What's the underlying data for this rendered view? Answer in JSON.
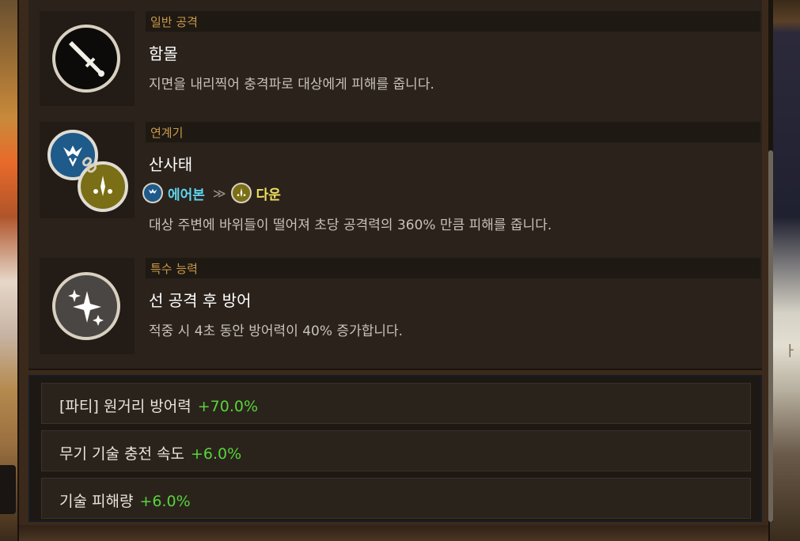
{
  "skills": [
    {
      "category": "일반 공격",
      "name": "함몰",
      "description": "지면을 내리찍어 충격파로 대상에게 피해를 줍니다.",
      "icon": "sword-icon"
    },
    {
      "category": "연계기",
      "name": "산사태",
      "combo": {
        "from": "에어본",
        "to": "다운",
        "arrow": "≫"
      },
      "description": "대상 주변에 바위들이 떨어져 초당 공격력의 360% 만큼 피해를 줍니다.",
      "icon": "chain-combo-icon"
    },
    {
      "category": "특수 능력",
      "name": "선 공격 후 방어",
      "description": "적중 시 4초 동안 방어력이 40% 증가합니다.",
      "icon": "sparkle-icon"
    }
  ],
  "stats": [
    {
      "label": "[파티] 원거리 방어력",
      "value": "+70.0%"
    },
    {
      "label": "무기 기술 충전 속도",
      "value": "+6.0%"
    },
    {
      "label": "기술 피해량",
      "value": "+6.0%"
    }
  ],
  "colors": {
    "category_text": "#c89a4a",
    "airborne": "#5fd4f0",
    "down": "#f0e060",
    "stat_value": "#58d43a"
  }
}
